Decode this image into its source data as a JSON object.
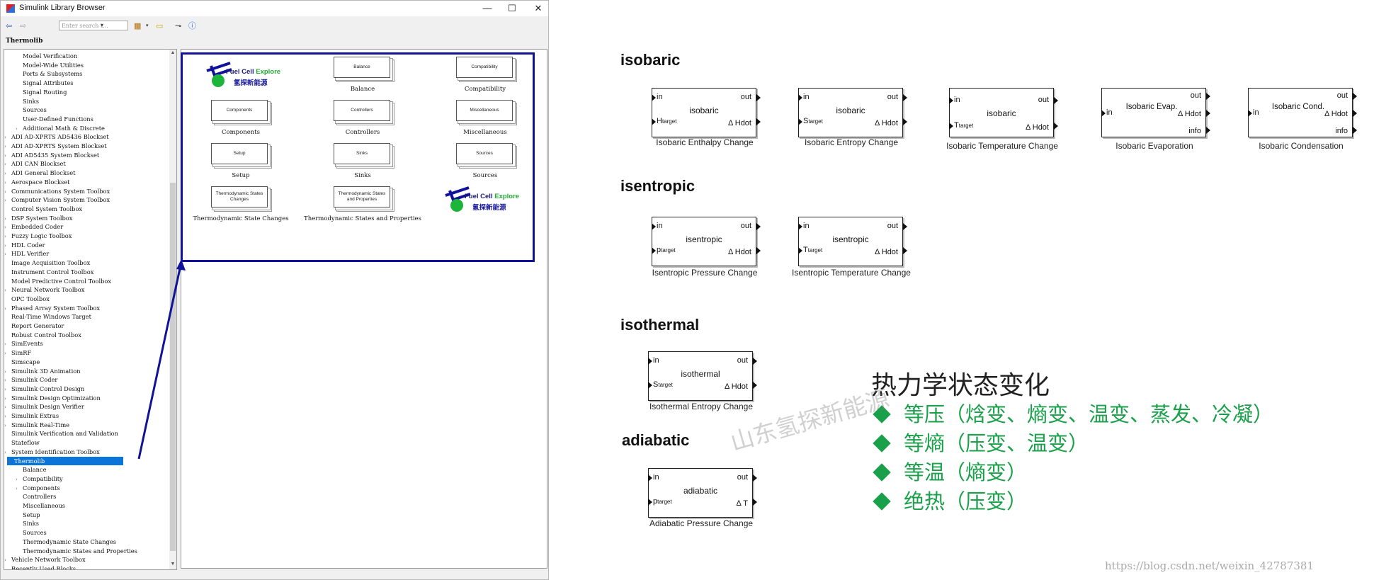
{
  "window": {
    "title": "Simulink Library Browser",
    "minimize": "—",
    "maximize": "☐",
    "close": "✕"
  },
  "toolbar": {
    "search_placeholder": "Enter search t..."
  },
  "breadcrumb": "Thermolib",
  "tree": [
    {
      "label": "Model Verification",
      "indent": 2,
      "arrow": ""
    },
    {
      "label": "Model-Wide Utilities",
      "indent": 2,
      "arrow": ""
    },
    {
      "label": "Ports & Subsystems",
      "indent": 2,
      "arrow": ""
    },
    {
      "label": "Signal Attributes",
      "indent": 2,
      "arrow": ""
    },
    {
      "label": "Signal Routing",
      "indent": 2,
      "arrow": ""
    },
    {
      "label": "Sinks",
      "indent": 2,
      "arrow": ""
    },
    {
      "label": "Sources",
      "indent": 2,
      "arrow": ""
    },
    {
      "label": "User-Defined Functions",
      "indent": 2,
      "arrow": ""
    },
    {
      "label": "Additional Math & Discrete",
      "indent": 2,
      "arrow": ">"
    },
    {
      "label": "ADI AD-XPRTS AD5436 Blockset",
      "indent": 1,
      "arrow": ">"
    },
    {
      "label": "ADI AD-XPRTS System Blockset",
      "indent": 1,
      "arrow": ">"
    },
    {
      "label": "ADI AD5435 System Blockset",
      "indent": 1,
      "arrow": ">"
    },
    {
      "label": "ADI CAN Blockset",
      "indent": 1,
      "arrow": ">"
    },
    {
      "label": "ADI General Blockset",
      "indent": 1,
      "arrow": ">"
    },
    {
      "label": "Aerospace Blockset",
      "indent": 1,
      "arrow": ">"
    },
    {
      "label": "Communications System Toolbox",
      "indent": 1,
      "arrow": ">"
    },
    {
      "label": "Computer Vision System Toolbox",
      "indent": 1,
      "arrow": ">"
    },
    {
      "label": "Control System Toolbox",
      "indent": 1,
      "arrow": ""
    },
    {
      "label": "DSP System Toolbox",
      "indent": 1,
      "arrow": ">"
    },
    {
      "label": "Embedded Coder",
      "indent": 1,
      "arrow": ">"
    },
    {
      "label": "Fuzzy Logic Toolbox",
      "indent": 1,
      "arrow": ">"
    },
    {
      "label": "HDL Coder",
      "indent": 1,
      "arrow": ">"
    },
    {
      "label": "HDL Verifier",
      "indent": 1,
      "arrow": ">"
    },
    {
      "label": "Image Acquisition Toolbox",
      "indent": 1,
      "arrow": ""
    },
    {
      "label": "Instrument Control Toolbox",
      "indent": 1,
      "arrow": ""
    },
    {
      "label": "Model Predictive Control Toolbox",
      "indent": 1,
      "arrow": ""
    },
    {
      "label": "Neural Network Toolbox",
      "indent": 1,
      "arrow": ">"
    },
    {
      "label": "OPC Toolbox",
      "indent": 1,
      "arrow": ""
    },
    {
      "label": "Phased Array System Toolbox",
      "indent": 1,
      "arrow": ">"
    },
    {
      "label": "Real-Time Windows Target",
      "indent": 1,
      "arrow": ""
    },
    {
      "label": "Report Generator",
      "indent": 1,
      "arrow": ""
    },
    {
      "label": "Robust Control Toolbox",
      "indent": 1,
      "arrow": ""
    },
    {
      "label": "SimEvents",
      "indent": 1,
      "arrow": ">"
    },
    {
      "label": "SimRF",
      "indent": 1,
      "arrow": ">"
    },
    {
      "label": "Simscape",
      "indent": 1,
      "arrow": ""
    },
    {
      "label": "Simulink 3D Animation",
      "indent": 1,
      "arrow": ">"
    },
    {
      "label": "Simulink Coder",
      "indent": 1,
      "arrow": ">"
    },
    {
      "label": "Simulink Control Design",
      "indent": 1,
      "arrow": ">"
    },
    {
      "label": "Simulink Design Optimization",
      "indent": 1,
      "arrow": ">"
    },
    {
      "label": "Simulink Design Verifier",
      "indent": 1,
      "arrow": ">"
    },
    {
      "label": "Simulink Extras",
      "indent": 1,
      "arrow": ">"
    },
    {
      "label": "Simulink Real-Time",
      "indent": 1,
      "arrow": ">"
    },
    {
      "label": "Simulink Verification and Validation",
      "indent": 1,
      "arrow": ""
    },
    {
      "label": "Stateflow",
      "indent": 1,
      "arrow": ""
    },
    {
      "label": "System Identification Toolbox",
      "indent": 1,
      "arrow": ">"
    },
    {
      "label": "Thermolib",
      "indent": 1,
      "arrow": "v",
      "selected": true
    },
    {
      "label": "Balance",
      "indent": 2,
      "arrow": ""
    },
    {
      "label": "Compatibility",
      "indent": 2,
      "arrow": ">"
    },
    {
      "label": "Components",
      "indent": 2,
      "arrow": ">"
    },
    {
      "label": "Controllers",
      "indent": 2,
      "arrow": ""
    },
    {
      "label": "Miscellaneous",
      "indent": 2,
      "arrow": ""
    },
    {
      "label": "Setup",
      "indent": 2,
      "arrow": ""
    },
    {
      "label": "Sinks",
      "indent": 2,
      "arrow": ""
    },
    {
      "label": "Sources",
      "indent": 2,
      "arrow": ""
    },
    {
      "label": "Thermodynamic State Changes",
      "indent": 2,
      "arrow": ""
    },
    {
      "label": "Thermodynamic States and Properties",
      "indent": 2,
      "arrow": ""
    },
    {
      "label": "Vehicle Network Toolbox",
      "indent": 1,
      "arrow": ">"
    },
    {
      "label": "Recently Used Blocks",
      "indent": 1,
      "arrow": ""
    }
  ],
  "library_blocks": {
    "balance": {
      "face": "Balance",
      "label": "Balance"
    },
    "compatibility": {
      "face": "Compatibility",
      "label": "Compatibility"
    },
    "components": {
      "face": "Components",
      "label": "Components"
    },
    "controllers": {
      "face": "Controllers",
      "label": "Controllers"
    },
    "miscellaneous": {
      "face": "Miscellaneous",
      "label": "Miscellaneous"
    },
    "setup": {
      "face": "Setup",
      "label": "Setup"
    },
    "sinks": {
      "face": "Sinks",
      "label": "Sinks"
    },
    "sources": {
      "face": "Sources",
      "label": "Sources"
    },
    "thermo_changes": {
      "face": "Thermodynamic States Changes",
      "label": "Thermodynamic State Changes"
    },
    "thermo_states": {
      "face": "Thermodynamic States and Properties",
      "label": "Thermodynamic States and Properties"
    }
  },
  "logo": {
    "en1": "Fuel Cell",
    "en2": "Explore",
    "cn": "氢探新能源"
  },
  "sections": {
    "isobaric": "isobaric",
    "isentropic": "isentropic",
    "isothermal": "isothermal",
    "adiabatic": "adiabatic"
  },
  "blocks": {
    "iso_enthalpy": {
      "title": "isobaric",
      "in": "in",
      "out": "out",
      "tgt": "H",
      "tgt_sub": "target",
      "delta": "Δ Hdot",
      "caption": "Isobaric Enthalpy Change"
    },
    "iso_entropy": {
      "title": "isobaric",
      "in": "in",
      "out": "out",
      "tgt": "S",
      "tgt_sub": "target",
      "delta": "Δ Hdot",
      "caption": "Isobaric Entropy Change"
    },
    "iso_temp": {
      "title": "isobaric",
      "in": "in",
      "out": "out",
      "tgt": "T",
      "tgt_sub": "target",
      "delta": "Δ Hdot",
      "caption": "Isobaric Temperature Change"
    },
    "iso_evap": {
      "title": "Isobaric Evap.",
      "in": "in",
      "out": "out",
      "delta": "Δ Hdot",
      "info": "info",
      "caption": "Isobaric Evaporation"
    },
    "iso_cond": {
      "title": "Isobaric Cond.",
      "in": "in",
      "out": "out",
      "delta": "Δ Hdot",
      "info": "info",
      "caption": "Isobaric Condensation"
    },
    "isen_press": {
      "title": "isentropic",
      "in": "in",
      "out": "out",
      "tgt": "p",
      "tgt_sub": "target",
      "delta": "Δ Hdot",
      "caption": "Isentropic Pressure Change"
    },
    "isen_temp": {
      "title": "isentropic",
      "in": "in",
      "out": "out",
      "tgt": "T",
      "tgt_sub": "target",
      "delta": "Δ Hdot",
      "caption": "Isentropic Temperature Change"
    },
    "isoth_entropy": {
      "title": "isothermal",
      "in": "in",
      "out": "out",
      "tgt": "S",
      "tgt_sub": "target",
      "delta": "Δ Hdot",
      "caption": "Isothermal Entropy Change"
    },
    "adia_press": {
      "title": "adiabatic",
      "in": "in",
      "out": "out",
      "tgt": "p",
      "tgt_sub": "target",
      "delta": "Δ T",
      "caption": "Adiabatic Pressure Change"
    }
  },
  "zh": {
    "title": "热力学状态变化",
    "items": [
      "等压（焓变、熵变、温变、蒸发、冷凝）",
      "等熵（压变、温变）",
      "等温（熵变）",
      "绝热（压变）"
    ]
  },
  "watermark": "山东氢探新能源",
  "url": "https://blog.csdn.net/weixin_42787381",
  "colors": {
    "highlight": "#11129a",
    "green": "#1aa04a",
    "selection": "#0a74d8"
  }
}
